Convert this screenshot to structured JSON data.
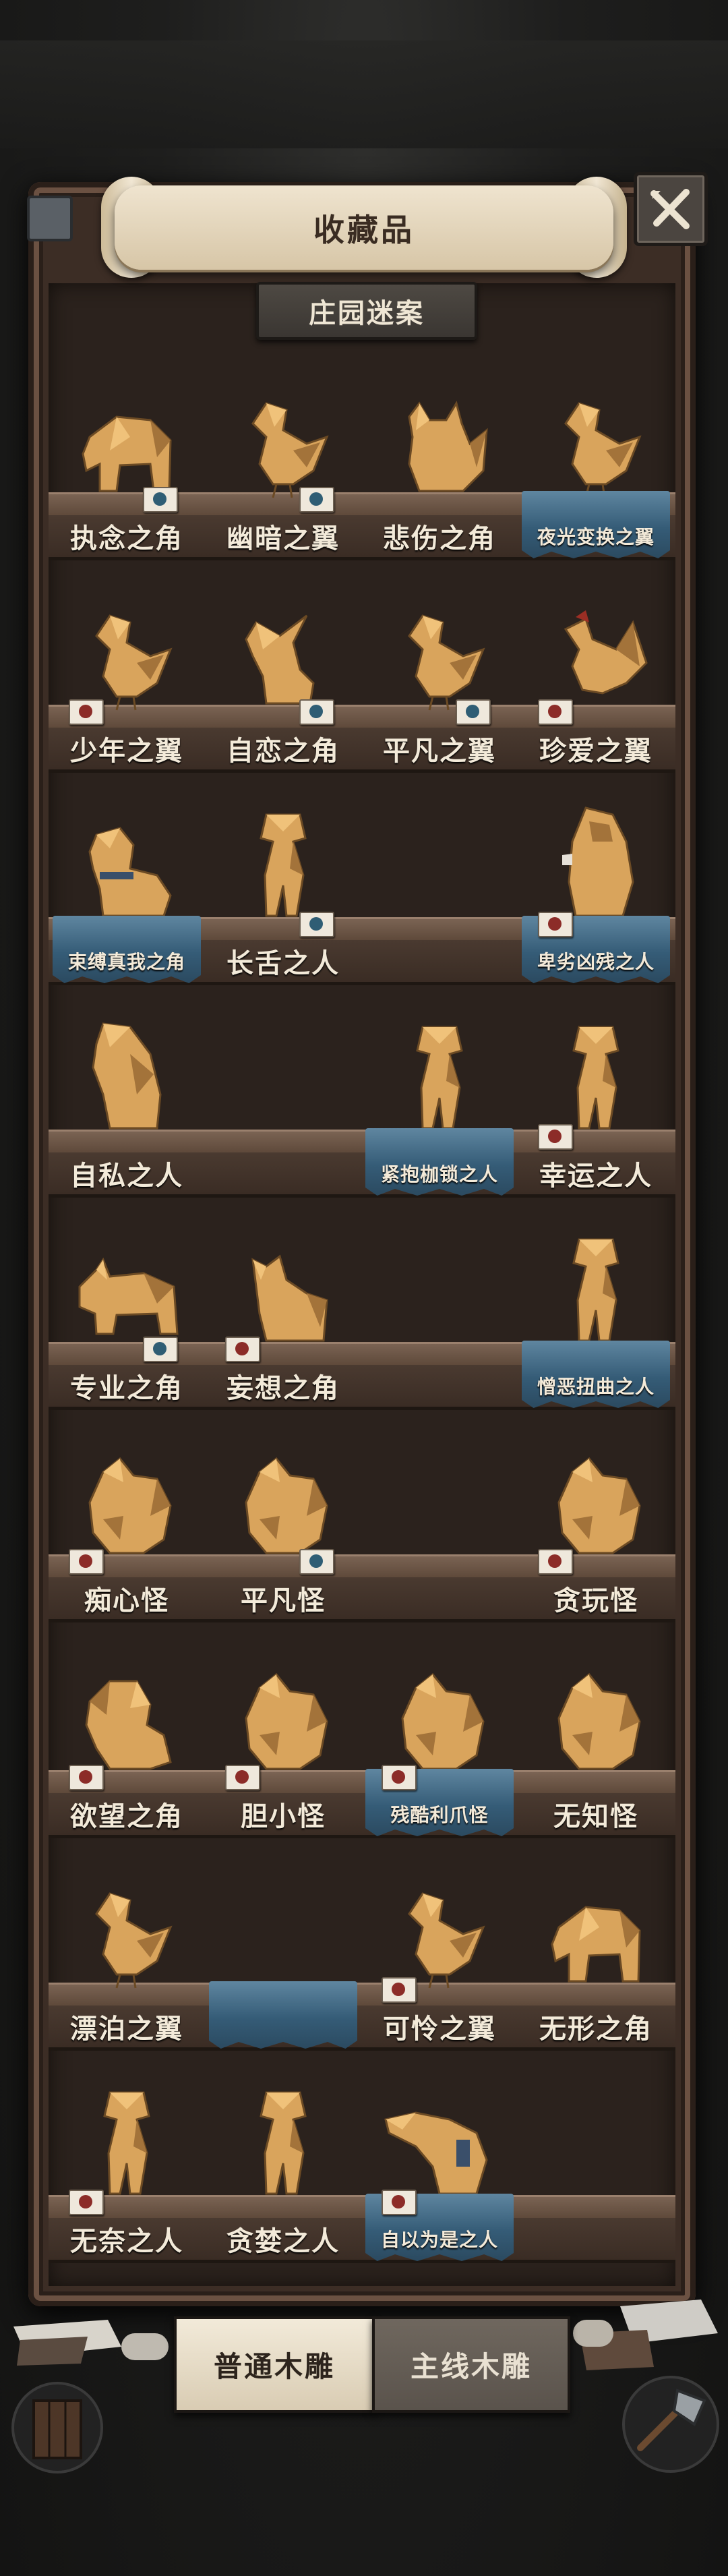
{
  "window": {
    "title": "收藏品"
  },
  "chapter": {
    "name": "庄园迷案"
  },
  "tabs": [
    {
      "label": "普通木雕",
      "active": true
    },
    {
      "label": "主线木雕",
      "active": false
    }
  ],
  "colors": {
    "wood": "#d9a45c",
    "cloth": "#3f6a87",
    "tag_red": "#8c2c28",
    "tag_blue": "#2f5d74"
  },
  "shelves": [
    {
      "slots": [
        {
          "label": "执念之角",
          "figure": "elephant-carving",
          "cloth": false,
          "tag": "blue"
        },
        {
          "label": "幽暗之翼",
          "figure": "bird-carving",
          "cloth": false,
          "tag": "blue"
        },
        {
          "label": "悲伤之角",
          "figure": "fox-carving",
          "cloth": false,
          "tag": ""
        },
        {
          "label": "夜光变换之翼",
          "figure": "bird-carving",
          "cloth": true,
          "tag": ""
        }
      ]
    },
    {
      "slots": [
        {
          "label": "少年之翼",
          "figure": "bird-carving",
          "cloth": false,
          "tag": "red"
        },
        {
          "label": "自恋之角",
          "figure": "goat-carving",
          "cloth": false,
          "tag": "blue"
        },
        {
          "label": "平凡之翼",
          "figure": "bird-carving",
          "cloth": false,
          "tag": "blue"
        },
        {
          "label": "珍爱之翼",
          "figure": "rooster-carving",
          "cloth": false,
          "tag": "red"
        }
      ]
    },
    {
      "slots": [
        {
          "label": "束缚真我之角",
          "figure": "dog-carving",
          "cloth": true,
          "tag": ""
        },
        {
          "label": "长舌之人",
          "figure": "person-carving",
          "cloth": false,
          "tag": "blue"
        },
        {
          "label": "",
          "figure": "",
          "cloth": false,
          "tag": ""
        },
        {
          "label": "卑劣凶残之人",
          "figure": "hooded-person-carving",
          "cloth": true,
          "tag": "red"
        }
      ]
    },
    {
      "slots": [
        {
          "label": "自私之人",
          "figure": "hunched-person-carving",
          "cloth": false,
          "tag": ""
        },
        {
          "label": "",
          "figure": "",
          "cloth": false,
          "tag": ""
        },
        {
          "label": "紧抱枷锁之人",
          "figure": "person-carving",
          "cloth": true,
          "tag": ""
        },
        {
          "label": "幸运之人",
          "figure": "person-carving",
          "cloth": false,
          "tag": "red"
        }
      ]
    },
    {
      "slots": [
        {
          "label": "专业之角",
          "figure": "rhino-carving",
          "cloth": false,
          "tag": "blue"
        },
        {
          "label": "妄想之角",
          "figure": "cat-carving",
          "cloth": false,
          "tag": "red"
        },
        {
          "label": "",
          "figure": "",
          "cloth": false,
          "tag": ""
        },
        {
          "label": "憎恶扭曲之人",
          "figure": "person-carving",
          "cloth": true,
          "tag": ""
        }
      ]
    },
    {
      "slots": [
        {
          "label": "痴心怪",
          "figure": "monster-carving",
          "cloth": false,
          "tag": "red"
        },
        {
          "label": "平凡怪",
          "figure": "monster-carving",
          "cloth": false,
          "tag": "blue"
        },
        {
          "label": "",
          "figure": "",
          "cloth": false,
          "tag": ""
        },
        {
          "label": "贪玩怪",
          "figure": "monster-carving",
          "cloth": false,
          "tag": "red"
        }
      ]
    },
    {
      "slots": [
        {
          "label": "欲望之角",
          "figure": "lion-carving",
          "cloth": false,
          "tag": "red"
        },
        {
          "label": "胆小怪",
          "figure": "monster-carving",
          "cloth": false,
          "tag": "red"
        },
        {
          "label": "残酷利爪怪",
          "figure": "monster-carving",
          "cloth": true,
          "tag": "red"
        },
        {
          "label": "无知怪",
          "figure": "monster-carving",
          "cloth": false,
          "tag": ""
        }
      ]
    },
    {
      "slots": [
        {
          "label": "漂泊之翼",
          "figure": "bird-carving",
          "cloth": false,
          "tag": ""
        },
        {
          "label": "",
          "figure": "",
          "cloth": true,
          "tag": ""
        },
        {
          "label": "可怜之翼",
          "figure": "bird-carving",
          "cloth": false,
          "tag": "red"
        },
        {
          "label": "无形之角",
          "figure": "elephant-carving",
          "cloth": false,
          "tag": ""
        }
      ]
    },
    {
      "slots": [
        {
          "label": "无奈之人",
          "figure": "person-carving",
          "cloth": false,
          "tag": "red"
        },
        {
          "label": "贪婪之人",
          "figure": "person-carving",
          "cloth": false,
          "tag": ""
        },
        {
          "label": "自以为是之人",
          "figure": "anteater-carving",
          "cloth": true,
          "tag": "red"
        },
        {
          "label": "",
          "figure": "",
          "cloth": false,
          "tag": ""
        }
      ]
    }
  ]
}
